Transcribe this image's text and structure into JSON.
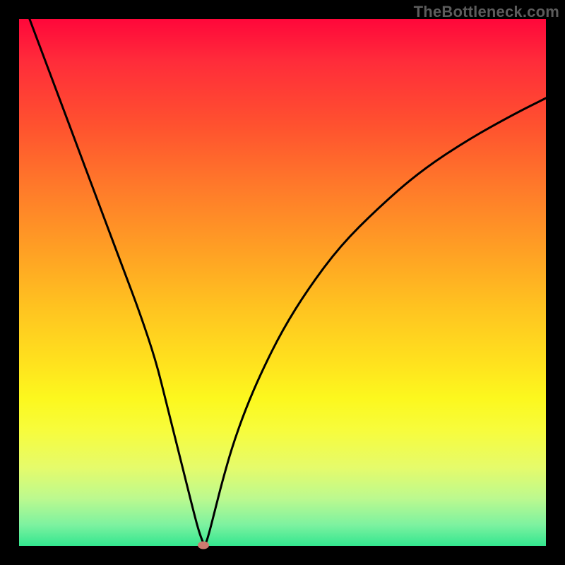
{
  "watermark": "TheBottleneck.com",
  "colors": {
    "frame": "#000000",
    "curve": "#000000",
    "marker": "#cc7a6f"
  },
  "chart_data": {
    "type": "line",
    "title": "",
    "xlabel": "",
    "ylabel": "",
    "xlim": [
      0,
      100
    ],
    "ylim": [
      0,
      100
    ],
    "grid": false,
    "x": [
      2,
      5,
      8,
      11,
      14,
      17,
      20,
      23,
      26,
      28,
      30,
      31.5,
      33,
      34,
      34.8,
      35.2,
      35.5,
      36,
      37,
      38.5,
      40.5,
      43,
      46,
      50,
      55,
      61,
      68,
      76,
      85,
      94,
      100
    ],
    "values": [
      100,
      92,
      84,
      76,
      68,
      60,
      52,
      44,
      35,
      27,
      19,
      13,
      7,
      3.2,
      0.9,
      0.2,
      0.6,
      2.2,
      6,
      12,
      19,
      26,
      33,
      41,
      49,
      57,
      64,
      71,
      77,
      82,
      85
    ],
    "marker": {
      "x": 35,
      "y": 0.2
    },
    "notes": "V-shaped bottleneck curve; minimum bottleneck near x≈35. Values estimated from pixel positions; no axis ticks or numeric labels are visible in the source image."
  }
}
